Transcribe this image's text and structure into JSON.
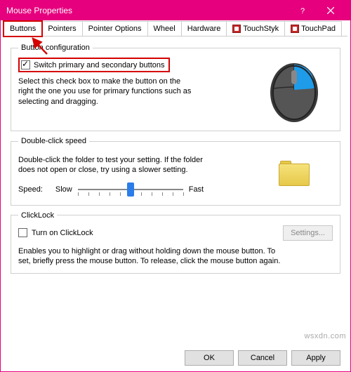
{
  "window": {
    "title": "Mouse Properties"
  },
  "tabs": {
    "items": [
      {
        "label": "Buttons"
      },
      {
        "label": "Pointers"
      },
      {
        "label": "Pointer Options"
      },
      {
        "label": "Wheel"
      },
      {
        "label": "Hardware"
      },
      {
        "label": "TouchStyk"
      },
      {
        "label": "TouchPad"
      }
    ],
    "active_index": 0
  },
  "button_config": {
    "legend": "Button configuration",
    "switch_label": "Switch primary and secondary buttons",
    "switch_checked": true,
    "description": "Select this check box to make the button on the right the one you use for primary functions such as selecting and dragging."
  },
  "double_click": {
    "legend": "Double-click speed",
    "description": "Double-click the folder to test your setting. If the folder does not open or close, try using a slower setting.",
    "speed_label": "Speed:",
    "slow_label": "Slow",
    "fast_label": "Fast",
    "slider_value": 5,
    "slider_min": 0,
    "slider_max": 10
  },
  "clicklock": {
    "legend": "ClickLock",
    "toggle_label": "Turn on ClickLock",
    "toggle_checked": false,
    "settings_label": "Settings...",
    "settings_enabled": false,
    "description": "Enables you to highlight or drag without holding down the mouse button. To set, briefly press the mouse button. To release, click the mouse button again."
  },
  "buttons": {
    "ok": "OK",
    "cancel": "Cancel",
    "apply": "Apply"
  },
  "watermark": "wsxdn.com"
}
